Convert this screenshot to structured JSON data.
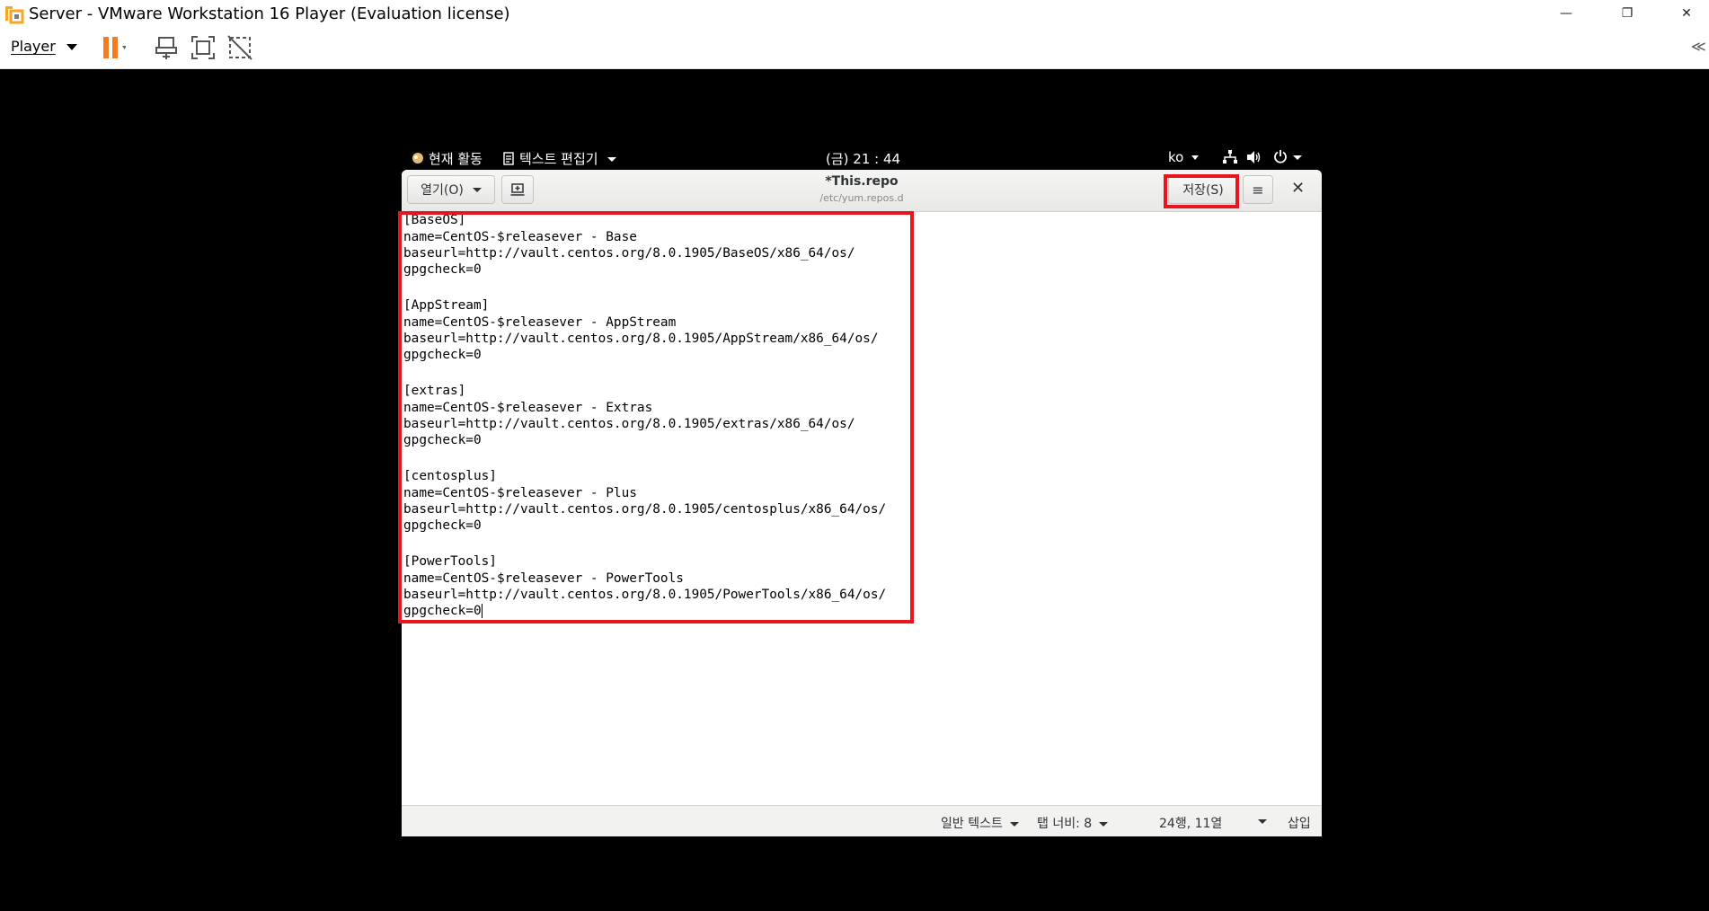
{
  "vmware": {
    "window_title": "Server - VMware Workstation 16 Player (Evaluation license)",
    "player_menu": "Player",
    "collapse_glyph": "≪",
    "controls": {
      "minimize": "—",
      "restore": "❐",
      "close": "✕"
    },
    "toolbar_icons": [
      "pause-icon",
      "send-ctrl-alt-del-icon",
      "fullscreen-icon",
      "unity-icon"
    ],
    "accent_color": "#f47b20"
  },
  "gnome": {
    "activities": "현재 활동",
    "app_menu": "텍스트 편집기",
    "clock": "(금) 21 : 44",
    "input_method": "ko"
  },
  "gedit": {
    "open_button": "열기(O)",
    "document_title": "*This.repo",
    "document_path": "/etc/yum.repos.d",
    "save_button": "저장(S)",
    "menu_glyph": "≡",
    "close_glyph": "✕",
    "lines": [
      "[BaseOS]",
      "name=CentOS-$releasever - Base",
      "baseurl=http://vault.centos.org/8.0.1905/BaseOS/x86_64/os/",
      "gpgcheck=0",
      "",
      "[AppStream]",
      "name=CentOS-$releasever - AppStream",
      "baseurl=http://vault.centos.org/8.0.1905/AppStream/x86_64/os/",
      "gpgcheck=0",
      "",
      "[extras]",
      "name=CentOS-$releasever - Extras",
      "baseurl=http://vault.centos.org/8.0.1905/extras/x86_64/os/",
      "gpgcheck=0",
      "",
      "[centosplus]",
      "name=CentOS-$releasever - Plus",
      "baseurl=http://vault.centos.org/8.0.1905/centosplus/x86_64/os/",
      "gpgcheck=0",
      "",
      "[PowerTools]",
      "name=CentOS-$releasever - PowerTools",
      "baseurl=http://vault.centos.org/8.0.1905/PowerTools/x86_64/os/",
      "gpgcheck=0"
    ],
    "status": {
      "syntax": "일반 텍스트",
      "tab_width": "탭 너비: 8",
      "position": "24행, 11열",
      "mode": "삽입"
    }
  },
  "annotation_color": "#e8141e"
}
